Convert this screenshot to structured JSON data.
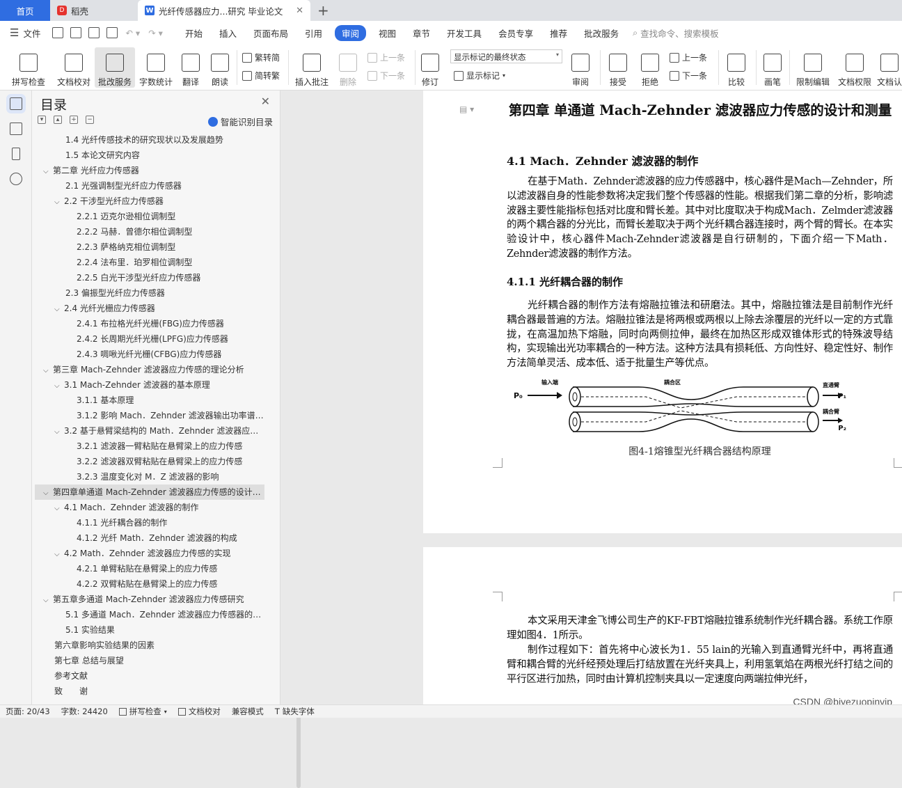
{
  "tabs": {
    "home": "首页",
    "daoke": "稻壳",
    "doc": "光纤传感器应力...研究 毕业论文",
    "close": "✕",
    "new": "+"
  },
  "menu": {
    "file": "文件",
    "items": [
      "开始",
      "插入",
      "页面布局",
      "引用",
      "审阅",
      "视图",
      "章节",
      "开发工具",
      "会员专享",
      "推荐",
      "批改服务"
    ],
    "search": "查找命令、搜索模板"
  },
  "ribbon": {
    "spellcheck": "拼写检查",
    "doc_proof": "文档校对",
    "review_service": "批改服务",
    "word_count": "字数统计",
    "translate": "翻译",
    "read_aloud": "朗读",
    "trad_simp": "繁转简",
    "simp_trad": "简转繁",
    "insert_comment": "插入批注",
    "delete": "删除",
    "prev1": "上一条",
    "next1": "下一条",
    "revise": "修订",
    "mark_state": "显示标记的最终状态",
    "show_marks": "显示标记",
    "review": "审阅",
    "accept": "接受",
    "reject": "拒绝",
    "prev2": "上一条",
    "next2": "下一条",
    "compare": "比较",
    "pen": "画笔",
    "restrict_edit": "限制编辑",
    "doc_perm": "文档权限",
    "doc_auth": "文档认"
  },
  "toc": {
    "title": "目录",
    "close": "✕",
    "smart": "智能识别目录",
    "items": [
      {
        "text": "1.4 光纤传感技术的研究现状以及发展趋势",
        "level": 2,
        "caret": ""
      },
      {
        "text": "1.5 本论文研究内容",
        "level": 2,
        "caret": ""
      },
      {
        "text": "第二章 光纤应力传感器",
        "level": 1,
        "caret": "v"
      },
      {
        "text": "2.1 光强调制型光纤应力传感器",
        "level": 2,
        "caret": ""
      },
      {
        "text": "2.2 干涉型光纤应力传感器",
        "level": 2,
        "caret": "v"
      },
      {
        "text": "2.2.1 迈克尔逊相位调制型",
        "level": 3,
        "caret": ""
      },
      {
        "text": "2.2.2 马赫．曾德尔相位调制型",
        "level": 3,
        "caret": ""
      },
      {
        "text": "2.2.3 萨格纳克相位调制型",
        "level": 3,
        "caret": ""
      },
      {
        "text": "2.2.4 法布里．珀罗相位调制型",
        "level": 3,
        "caret": ""
      },
      {
        "text": "2.2.5 白光干涉型光纤应力传感器",
        "level": 3,
        "caret": ""
      },
      {
        "text": "2.3 偏振型光纤应力传感器",
        "level": 2,
        "caret": ""
      },
      {
        "text": "2.4 光纤光栅应力传感器",
        "level": 2,
        "caret": "v"
      },
      {
        "text": "2.4.1 布拉格光纤光栅(FBG)应力传感器",
        "level": 3,
        "caret": ""
      },
      {
        "text": "2.4.2 长周期光纤光栅(LPFG)应力传感器",
        "level": 3,
        "caret": ""
      },
      {
        "text": "2.4.3 啁啾光纤光栅(CFBG)应力传感器",
        "level": 3,
        "caret": ""
      },
      {
        "text": "第三章 Mach-Zehnder 滤波器应力传感的理论分析",
        "level": 1,
        "caret": "v"
      },
      {
        "text": "3.1 Mach-Zehnder 滤波器的基本原理",
        "level": 2,
        "caret": "v"
      },
      {
        "text": "3.1.1 基本原理",
        "level": 3,
        "caret": ""
      },
      {
        "text": "3.1.2 影响 Mach．Zehnder 滤波器输出功率谱…",
        "level": 3,
        "caret": ""
      },
      {
        "text": "3.2 基于悬臂梁结构的 Math．Zehnder 滤波器应…",
        "level": 2,
        "caret": "v"
      },
      {
        "text": "3.2.1 滤波器一臂粘贴在悬臂梁上的应力传感",
        "level": 3,
        "caret": ""
      },
      {
        "text": "3.2.2 滤波器双臂粘贴在悬臂梁上的应力传感",
        "level": 3,
        "caret": ""
      },
      {
        "text": "3.2.3 温度变化对 M．Z 滤波器的影响",
        "level": 3,
        "caret": ""
      },
      {
        "text": "第四章单通道 Mach-Zehnder 滤波器应力传感的设计…",
        "level": 1,
        "caret": "v",
        "sel": true
      },
      {
        "text": "4.1 Mach．Zehnder 滤波器的制作",
        "level": 2,
        "caret": "v"
      },
      {
        "text": "4.1.1 光纤耦合器的制作",
        "level": 3,
        "caret": ""
      },
      {
        "text": "4.1.2 光纤 Math．Zehnder 滤波器的构成",
        "level": 3,
        "caret": ""
      },
      {
        "text": "4.2 Math．Zehnder 滤波器应力传感的实现",
        "level": 2,
        "caret": "v"
      },
      {
        "text": "4.2.1 单臂粘贴在悬臂梁上的应力传感",
        "level": 3,
        "caret": ""
      },
      {
        "text": "4.2.2 双臂粘贴在悬臂梁上的应力传感",
        "level": 3,
        "caret": ""
      },
      {
        "text": "第五章多通道 Mach-Zehnder 滤波器应力传感研究",
        "level": 1,
        "caret": "v"
      },
      {
        "text": "5.1 多通道 Mach．Zehnder 滤波器应力传感器的…",
        "level": 2,
        "caret": ""
      },
      {
        "text": "5.1 实验结果",
        "level": 2,
        "caret": ""
      },
      {
        "text": "第六章影响实验结果的因素",
        "level": 1,
        "caret": ""
      },
      {
        "text": "第七章 总结与展望",
        "level": 1,
        "caret": ""
      },
      {
        "text": "参考文献",
        "level": 1,
        "caret": ""
      },
      {
        "text": "致　　谢",
        "level": 1,
        "caret": ""
      }
    ]
  },
  "doc": {
    "chapter_title": "第四章 单通道 Mach-Zehnder 滤波器应力传感的设计和测量",
    "sec41": "4.1 Mach．Zehnder 滤波器的制作",
    "p1": "在基于Math．Zehnder滤波器的应力传感器中，核心器件是Mach—Zehnder，所以滤波器自身的性能参数将决定我们整个传感器的性能。根据我们第二章的分析，影响滤波器主要性能指标包括对比度和臂长差。其中对比度取决于构成Mach．Zelmder滤波器的两个耦合器的分光比，而臂长差取决于两个光纤耦合器连接时，两个臂的臂长。在本实验设计中，核心器件Mach-Zehnder滤波器是自行研制的，下面介绍一下Math．Zehnder滤波器的制作方法。",
    "sec411": "4.1.1 光纤耦合器的制作",
    "p2": "光纤耦合器的制作方法有熔融拉锥法和研磨法。其中，熔融拉锥法是目前制作光纤耦合器最普遍的方法。熔融拉锥法是将两根或两根以上除去涂覆层的光纤以一定的方式靠拢，在高温加热下熔融，同时向两侧拉伸，最终在加热区形成双锥体形式的特殊波导结构，实现输出光功率耦合的一种方法。这种方法具有损耗低、方向性好、稳定性好、制作方法简单灵活、成本低、适于批量生产等优点。",
    "fig_labels": {
      "input": "输入端",
      "coupling": "耦合区",
      "p0": "P₀",
      "direct": "直通臂",
      "p1": "P₁",
      "couple_arm": "耦合臂",
      "p2": "P₂"
    },
    "fig_caption": "图4-1熔锥型光纤耦合器结构原理",
    "p3": "本文采用天津金飞博公司生产的KF-FBT熔融拉锥系统制作光纤耦合器。系统工作原理如图4．1所示。",
    "p4": "制作过程如下：首先将中心波长为1．55 lain的光输入到直通臂光纤中，再将直通臂和耦合臂的光纤经预处理后打结放置在光纤夹具上，利用氢氧焰在两根光纤打结之间的平行区进行加热，同时由计算机控制夹具以一定速度向两端拉伸光纤，"
  },
  "status": {
    "page": "页面: 20/43",
    "words": "字数: 24420",
    "spell": "拼写检查",
    "proof": "文档校对",
    "compat": "兼容模式",
    "missing_font": "缺失字体"
  },
  "watermark": "CSDN @biyezuopinvip"
}
